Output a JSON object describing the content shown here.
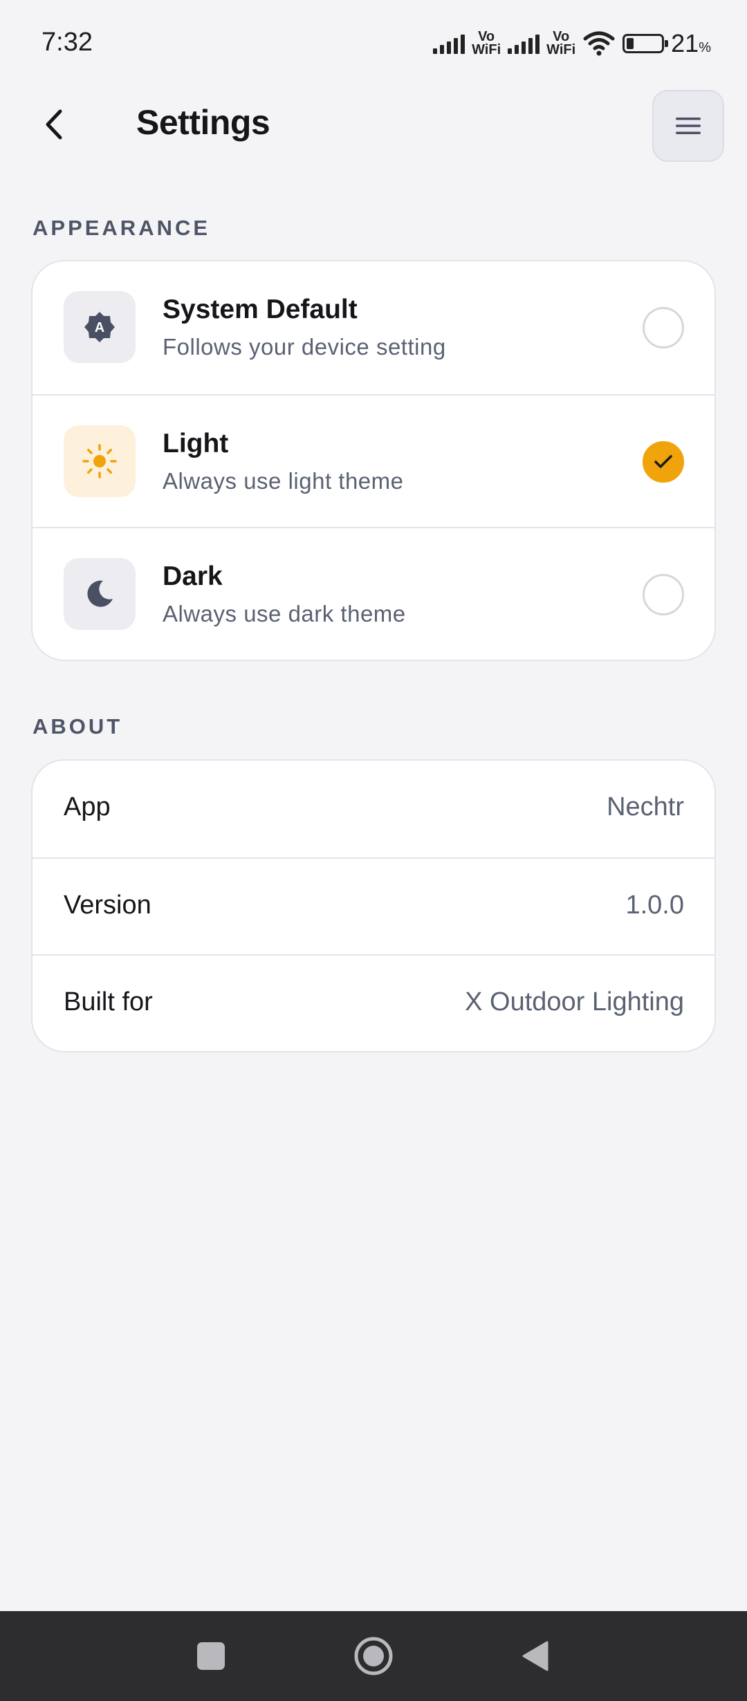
{
  "status_bar": {
    "time": "7:32",
    "vowifi_top": "Vo",
    "vowifi_bottom": "WiFi",
    "battery_level": 21,
    "battery_text": "21",
    "battery_unit": "%"
  },
  "header": {
    "title": "Settings",
    "back_icon": "chevron-left-icon",
    "menu_icon": "hamburger-menu-icon"
  },
  "appearance": {
    "section_label": "APPEARANCE",
    "options": [
      {
        "title": "System Default",
        "subtitle": "Follows your device setting",
        "icon": "auto-theme-icon",
        "icon_bg": "#ececf1",
        "selected": false
      },
      {
        "title": "Light",
        "subtitle": "Always use light theme",
        "icon": "sun-icon",
        "icon_bg": "#fdf1dc",
        "selected": true
      },
      {
        "title": "Dark",
        "subtitle": "Always use dark theme",
        "icon": "moon-icon",
        "icon_bg": "#ececf1",
        "selected": false
      }
    ]
  },
  "about": {
    "section_label": "ABOUT",
    "rows": [
      {
        "label": "App",
        "value": "Nechtr"
      },
      {
        "label": "Version",
        "value": "1.0.0"
      },
      {
        "label": "Built for",
        "value": "X Outdoor Lighting"
      }
    ]
  },
  "colors": {
    "accent": "#f0a30a",
    "background": "#f4f4f7",
    "card": "#ffffff",
    "muted_text": "#5a6172",
    "nav_bar": "#2d2d2f"
  },
  "nav": {
    "recents_icon": "square-recents-icon",
    "home_icon": "circle-home-icon",
    "back_icon": "triangle-back-icon"
  }
}
